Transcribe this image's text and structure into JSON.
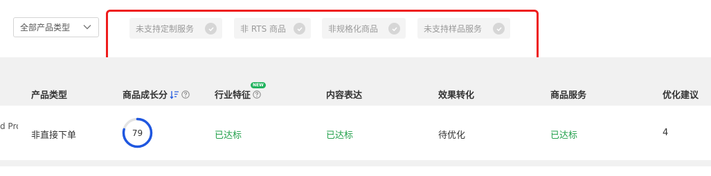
{
  "filter": {
    "type_select": "全部产品类型",
    "tags": [
      {
        "label": "未支持定制服务"
      },
      {
        "label": "非 RTS 商品"
      },
      {
        "label": "非规格化商品"
      },
      {
        "label": "未支持样品服务"
      }
    ]
  },
  "table": {
    "headers": {
      "product_type": "产品类型",
      "growth_score": "商品成长分",
      "industry": "行业特征",
      "content": "内容表达",
      "effect": "效果转化",
      "service": "商品服务",
      "suggestion": "优化建议"
    },
    "new_badge": "NEW",
    "row": {
      "name_fragment": "d Pro",
      "product_type": "非直接下单",
      "growth_score": 79,
      "industry": "已达标",
      "content": "已达标",
      "effect": "待优化",
      "service": "已达标",
      "suggestion": "4"
    }
  },
  "colors": {
    "highlight_border": "#ee1c1c",
    "status_ok": "#22a04b",
    "ring": "#1f57e0",
    "badge_new": "#22b35e"
  }
}
